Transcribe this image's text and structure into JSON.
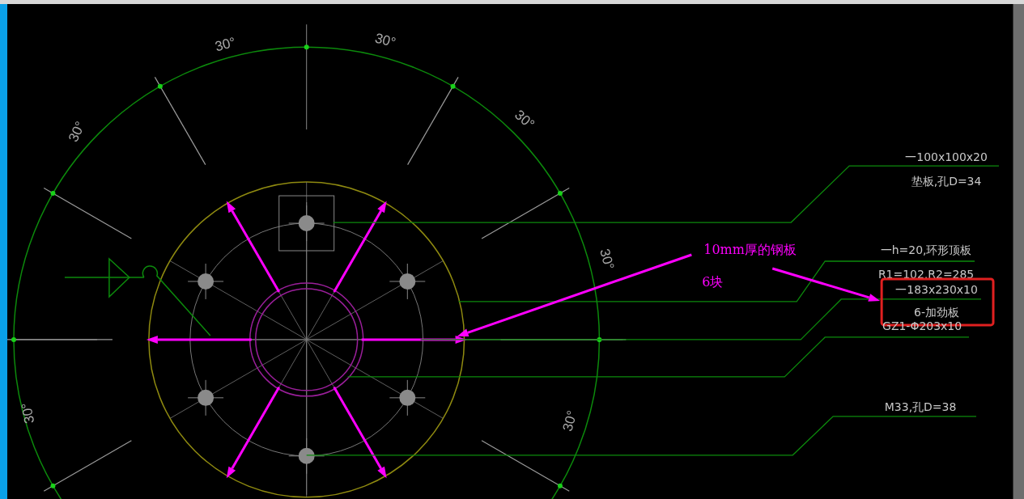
{
  "dimension_labels": [
    "30°",
    "30°",
    "30°",
    "30°",
    "30°",
    "30°",
    "30°"
  ],
  "leader_notes": [
    {
      "lines": [
        "一100x100x20",
        "垫板,孔D=34"
      ],
      "highlighted": false
    },
    {
      "lines": [
        "一h=20,环形顶板",
        "R1=102,R2=285"
      ],
      "highlighted": false
    },
    {
      "lines": [
        "一183x230x10",
        "6-加劲板"
      ],
      "highlighted": true
    },
    {
      "lines": [
        "GZ1-Φ203x10"
      ],
      "highlighted": false
    },
    {
      "lines": [
        "M33,孔D=38"
      ],
      "highlighted": false
    }
  ],
  "annotation": {
    "lines": [
      "10mm厚的钢板",
      "6块"
    ]
  }
}
